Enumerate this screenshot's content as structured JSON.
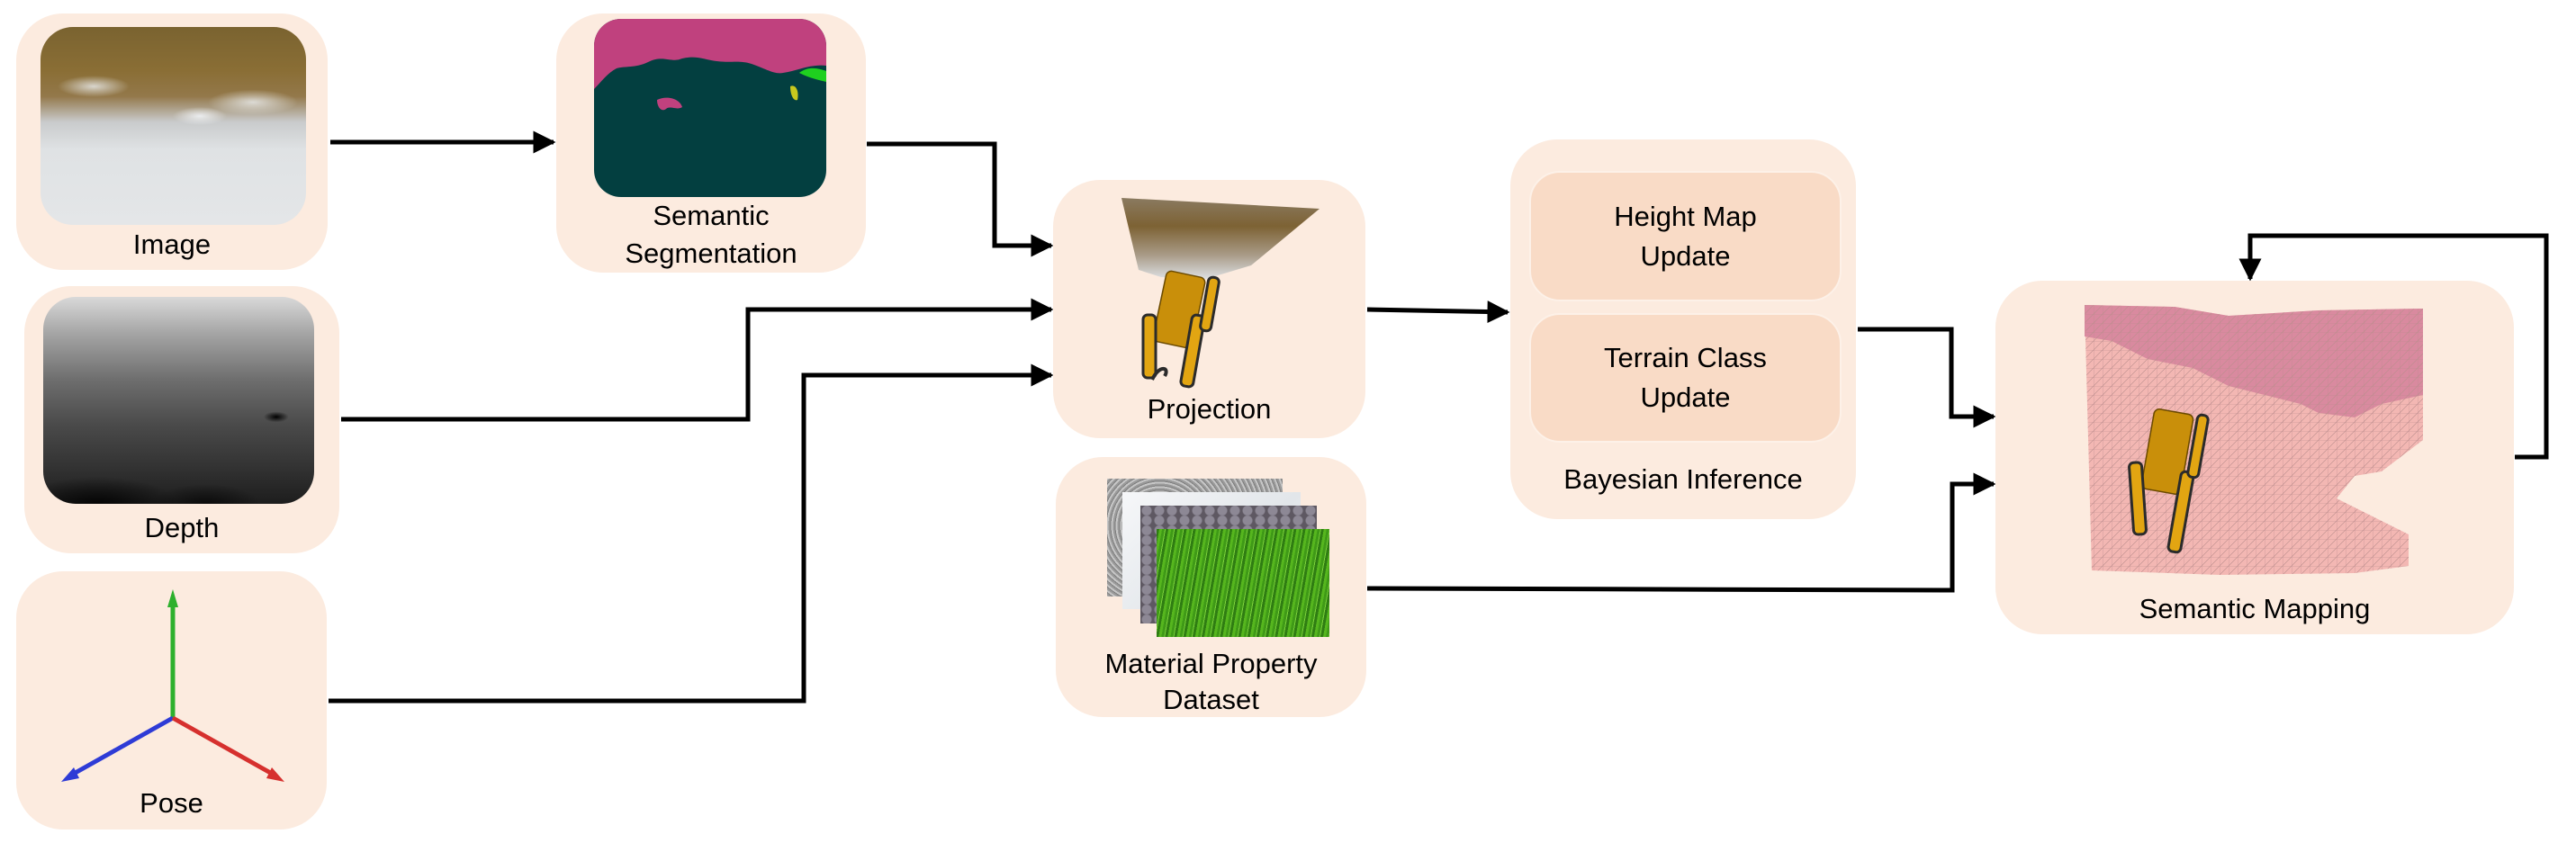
{
  "diagram": {
    "nodes": {
      "image": {
        "label": "Image",
        "thumbnail": "snowy-grass-photo"
      },
      "depth": {
        "label": "Depth",
        "thumbnail": "grayscale-depth-map"
      },
      "pose": {
        "label": "Pose",
        "thumbnail": "xyz-axes-icon",
        "axes_colors": {
          "up": "#2DB02D",
          "left": "#2E3BD6",
          "right": "#D6302E"
        }
      },
      "semantic_segmentation": {
        "label_line1": "Semantic",
        "label_line2": "Segmentation",
        "thumbnail": "segmentation-mask",
        "colors": {
          "ground": "#033F40",
          "sky_region": "#C0417E",
          "vegetation": "#1FD01F",
          "other": "#C8C81E"
        }
      },
      "projection": {
        "label": "Projection",
        "thumbnail": "robot-with-projected-point-cloud"
      },
      "material_property_dataset": {
        "label_line1": "Material Property",
        "label_line2": "Dataset",
        "thumbnail": "stacked-material-texture-images",
        "materials": [
          "gravel",
          "snow",
          "pebbles",
          "grass"
        ]
      },
      "bayesian_inference": {
        "label": "Bayesian Inference",
        "sub_blocks": [
          {
            "line1": "Height Map",
            "line2": "Update"
          },
          {
            "line1": "Terrain Class",
            "line2": "Update"
          }
        ]
      },
      "semantic_mapping": {
        "label": "Semantic Mapping",
        "thumbnail": "robot-on-semantic-mesh-map"
      }
    },
    "edges": [
      {
        "from": "Image",
        "to": "Semantic Segmentation"
      },
      {
        "from": "Semantic Segmentation",
        "to": "Projection"
      },
      {
        "from": "Depth",
        "to": "Projection"
      },
      {
        "from": "Pose",
        "to": "Projection"
      },
      {
        "from": "Projection",
        "to": "Bayesian Inference"
      },
      {
        "from": "Bayesian Inference",
        "to": "Semantic Mapping"
      },
      {
        "from": "Material Property Dataset",
        "to": "Semantic Mapping"
      },
      {
        "from": "Semantic Mapping",
        "to": "Semantic Mapping",
        "kind": "feedback-loop"
      }
    ],
    "colors": {
      "node_fill": "#FCEBDF",
      "sub_block_fill": "#F9DBC6",
      "edge": "#000000"
    }
  }
}
